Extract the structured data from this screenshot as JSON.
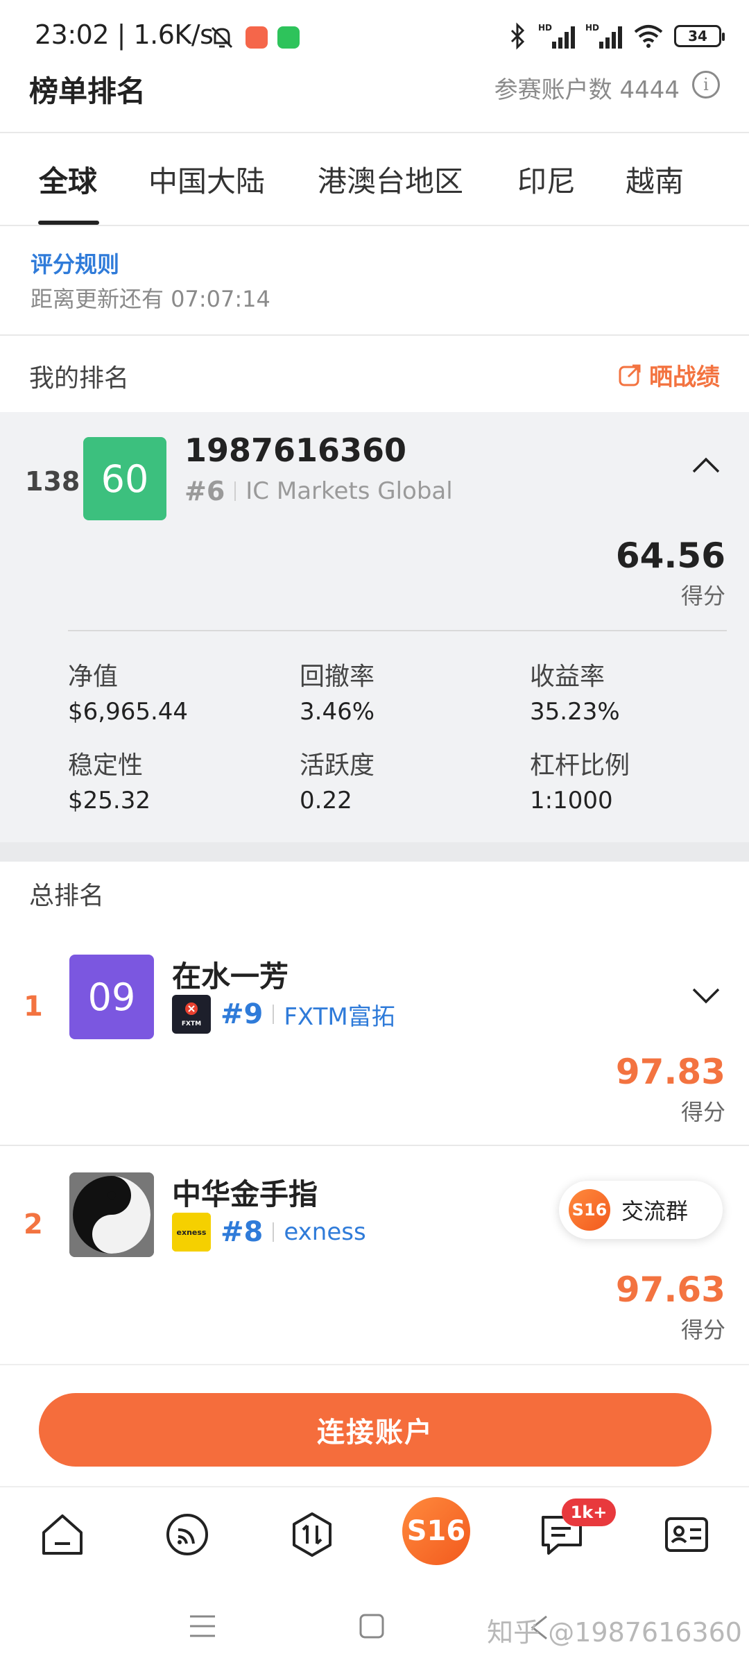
{
  "status_bar": {
    "time": "23:02",
    "net_speed": "| 1.6K/s",
    "battery": "34",
    "signal1": "HD",
    "signal2": "HD"
  },
  "header": {
    "title": "榜单排名",
    "participant_count": "参赛账户数 4444"
  },
  "tabs": [
    {
      "label": "全球",
      "active": true
    },
    {
      "label": "中国大陆",
      "active": false
    },
    {
      "label": "港澳台地区",
      "active": false
    },
    {
      "label": "印尼",
      "active": false
    },
    {
      "label": "越南",
      "active": false
    }
  ],
  "rules": {
    "link": "评分规则",
    "countdown": "距离更新还有 07:07:14"
  },
  "my_rank": {
    "section_label": "我的排名",
    "share_label": "晒战绩",
    "rank": "138",
    "badge": "60",
    "badge_color": "#3cc07e",
    "account": "1987616360",
    "hash": "#6",
    "broker": "IC Markets Global",
    "score": "64.56",
    "score_label": "得分",
    "stats": [
      {
        "key": "净值",
        "value": "$6,965.44"
      },
      {
        "key": "回撤率",
        "value": "3.46%"
      },
      {
        "key": "收益率",
        "value": "35.23%"
      },
      {
        "key": "稳定性",
        "value": "$25.32"
      },
      {
        "key": "活跃度",
        "value": "0.22"
      },
      {
        "key": "杠杆比例",
        "value": "1:1000"
      }
    ]
  },
  "total": {
    "section_label": "总排名",
    "rows": [
      {
        "rank": "1",
        "badge": "09",
        "badge_color": "#7b57e0",
        "name": "在水一芳",
        "broker_logo_text": "FXTM富拓",
        "hash": "#9",
        "broker": "FXTM富拓",
        "score": "97.83",
        "score_label": "得分"
      },
      {
        "rank": "2",
        "name": "中华金手指",
        "broker_logo_text": "exness",
        "hash": "#8",
        "broker": "exness",
        "score": "97.63",
        "score_label": "得分"
      }
    ]
  },
  "chat_float": {
    "logo": "S16",
    "label": "交流群"
  },
  "connect_button": "连接账户",
  "bottom_nav": {
    "center_logo": "S16",
    "notif_badge": "1k+"
  },
  "watermark": "知乎 @1987616360",
  "colors": {
    "accent": "#f56d3c",
    "link": "#2f7bd9"
  }
}
